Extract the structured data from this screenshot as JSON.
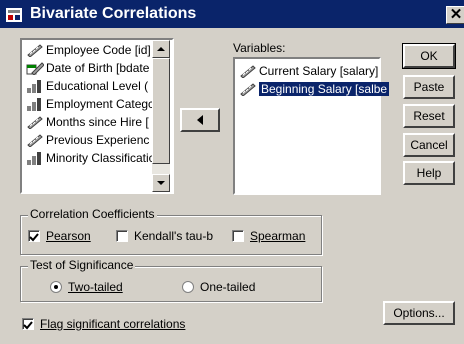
{
  "window": {
    "title": "Bivariate Correlations",
    "close_glyph": "✕"
  },
  "source_list": {
    "items": [
      {
        "label": "Employee Code [id]",
        "icon": "scale-icon"
      },
      {
        "label": "Date of Birth [bdate",
        "icon": "date-scale-icon"
      },
      {
        "label": "Educational Level (",
        "icon": "ordinal-icon"
      },
      {
        "label": "Employment Categc",
        "icon": "ordinal-icon"
      },
      {
        "label": "Months since Hire [",
        "icon": "scale-icon"
      },
      {
        "label": "Previous Experienc",
        "icon": "scale-icon"
      },
      {
        "label": "Minority Classificatic",
        "icon": "ordinal-icon"
      }
    ]
  },
  "variables": {
    "label": "Variables:",
    "items": [
      {
        "label": "Current Salary [salary]",
        "icon": "scale-icon"
      },
      {
        "label": "Beginning Salary [salbe",
        "icon": "scale-icon",
        "selected": true
      }
    ]
  },
  "buttons": {
    "ok": "OK",
    "paste": "Paste",
    "reset": "Reset",
    "cancel": "Cancel",
    "help": "Help",
    "options": "Options..."
  },
  "coefficients": {
    "title": "Correlation Coefficients",
    "pearson": {
      "label": "Pearson",
      "checked": true
    },
    "kendall": {
      "label": "Kendall's tau-b",
      "checked": false
    },
    "spearman": {
      "label": "Spearman",
      "checked": false
    }
  },
  "significance": {
    "title": "Test of Significance",
    "two_tailed": {
      "label": "Two-tailed",
      "selected": true
    },
    "one_tailed": {
      "label": "One-tailed",
      "selected": false
    }
  },
  "flag": {
    "label": "Flag significant correlations",
    "checked": true
  },
  "colors": {
    "title_bar": "#0a246a",
    "dialog": "#d4d0c8",
    "selection": "#0a246a"
  }
}
